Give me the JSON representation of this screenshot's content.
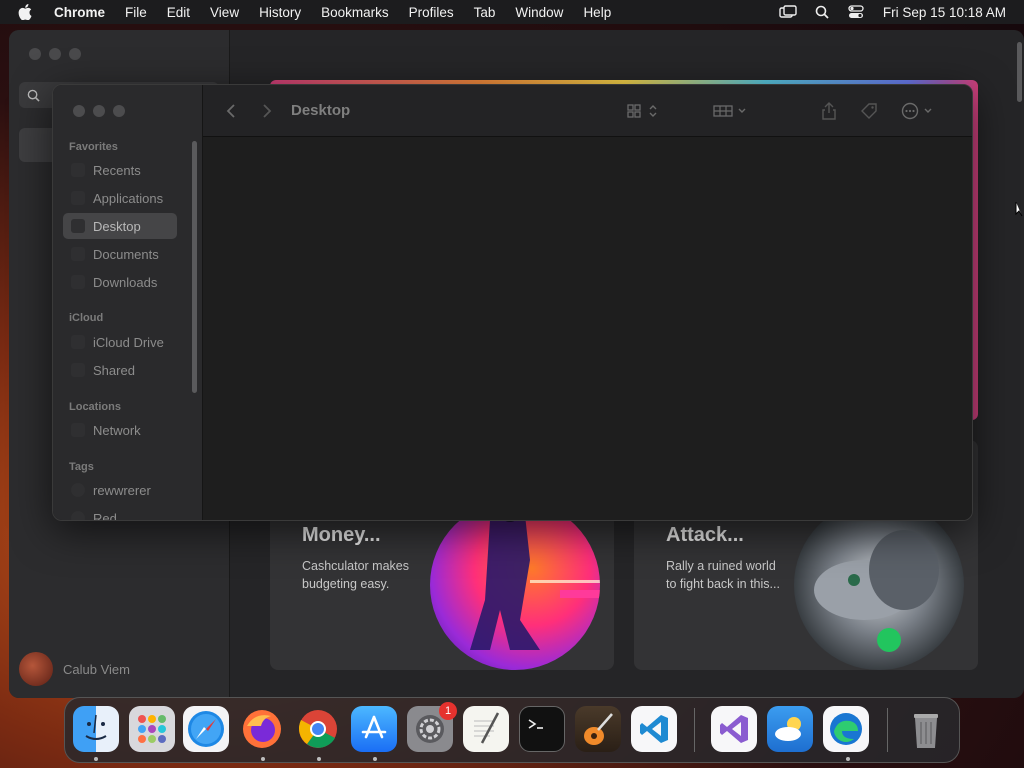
{
  "menubar": {
    "app_name": "Chrome",
    "items": [
      "File",
      "Edit",
      "View",
      "History",
      "Bookmarks",
      "Profiles",
      "Tab",
      "Window",
      "Help"
    ],
    "clock": "Fri Sep 15  10:18 AM"
  },
  "appstore": {
    "user_name": "Calub Viem",
    "cards": [
      {
        "title": "Money...",
        "desc": "Cashculator makes budgeting easy."
      },
      {
        "title": "Attack...",
        "desc": "Rally a ruined world to fight back in this..."
      }
    ]
  },
  "finder": {
    "title": "Desktop",
    "sections": {
      "favorites": "Favorites",
      "icloud": "iCloud",
      "locations": "Locations",
      "tags": "Tags"
    },
    "favorites": [
      "Recents",
      "Applications",
      "Desktop",
      "Documents",
      "Downloads"
    ],
    "icloud": [
      "iCloud Drive",
      "Shared"
    ],
    "locations": [
      "Network"
    ],
    "tags": [
      "rewwrerer",
      "Red"
    ]
  },
  "dock": {
    "settings_badge": "1"
  }
}
